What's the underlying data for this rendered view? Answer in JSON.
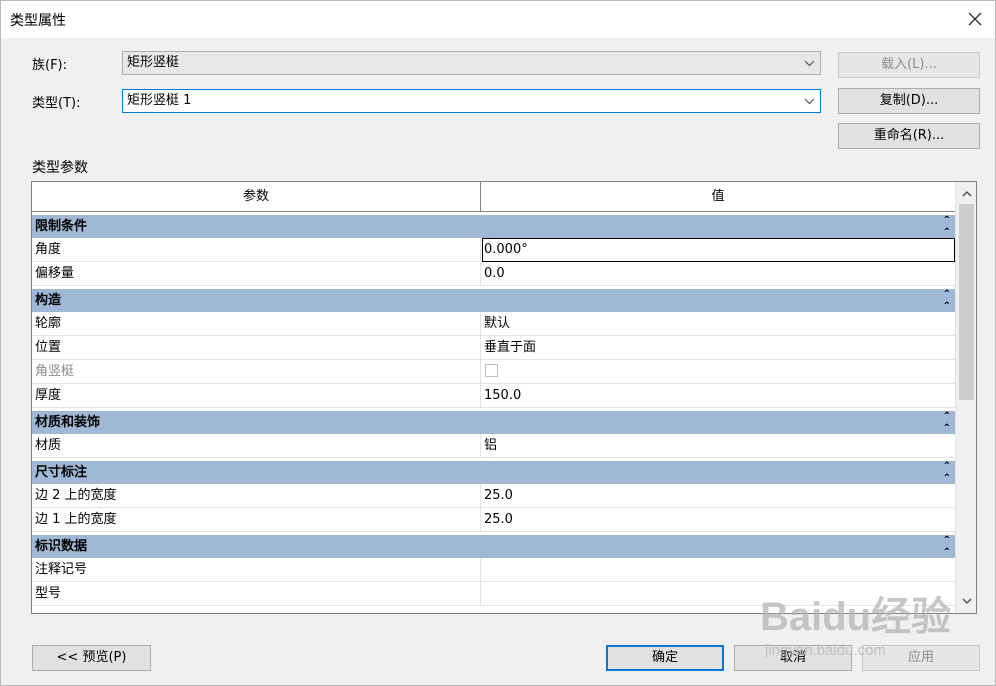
{
  "window": {
    "title": "类型属性"
  },
  "family": {
    "label": "族(F):",
    "value": "矩形竖梃"
  },
  "type": {
    "label": "类型(T):",
    "value": "矩形竖梃 1"
  },
  "buttons": {
    "load": "载入(L)...",
    "duplicate": "复制(D)...",
    "rename": "重命名(R)...",
    "preview": "<< 预览(P)",
    "ok": "确定",
    "cancel": "取消",
    "apply": "应用"
  },
  "section": {
    "caption": "类型参数"
  },
  "grid": {
    "headers": {
      "param": "参数",
      "value": "值"
    },
    "groups": [
      {
        "title": "限制条件",
        "rows": [
          {
            "name": "角度",
            "value": "0.000°",
            "selected": true
          },
          {
            "name": "偏移量",
            "value": "0.0"
          }
        ]
      },
      {
        "title": "构造",
        "rows": [
          {
            "name": "轮廓",
            "value": "默认"
          },
          {
            "name": "位置",
            "value": "垂直于面"
          },
          {
            "name": "角竖梃",
            "value": "",
            "checkbox": true,
            "disabled": true
          },
          {
            "name": "厚度",
            "value": "150.0"
          }
        ]
      },
      {
        "title": "材质和装饰",
        "rows": [
          {
            "name": "材质",
            "value": "铝"
          }
        ]
      },
      {
        "title": "尺寸标注",
        "rows": [
          {
            "name": "边 2 上的宽度",
            "value": "25.0"
          },
          {
            "name": "边 1 上的宽度",
            "value": "25.0"
          }
        ]
      },
      {
        "title": "标识数据",
        "rows": [
          {
            "name": "注释记号",
            "value": ""
          },
          {
            "name": "型号",
            "value": ""
          }
        ]
      }
    ]
  },
  "watermark": {
    "logo": "Baidu经验",
    "url": "jingyan.baidu.com"
  }
}
